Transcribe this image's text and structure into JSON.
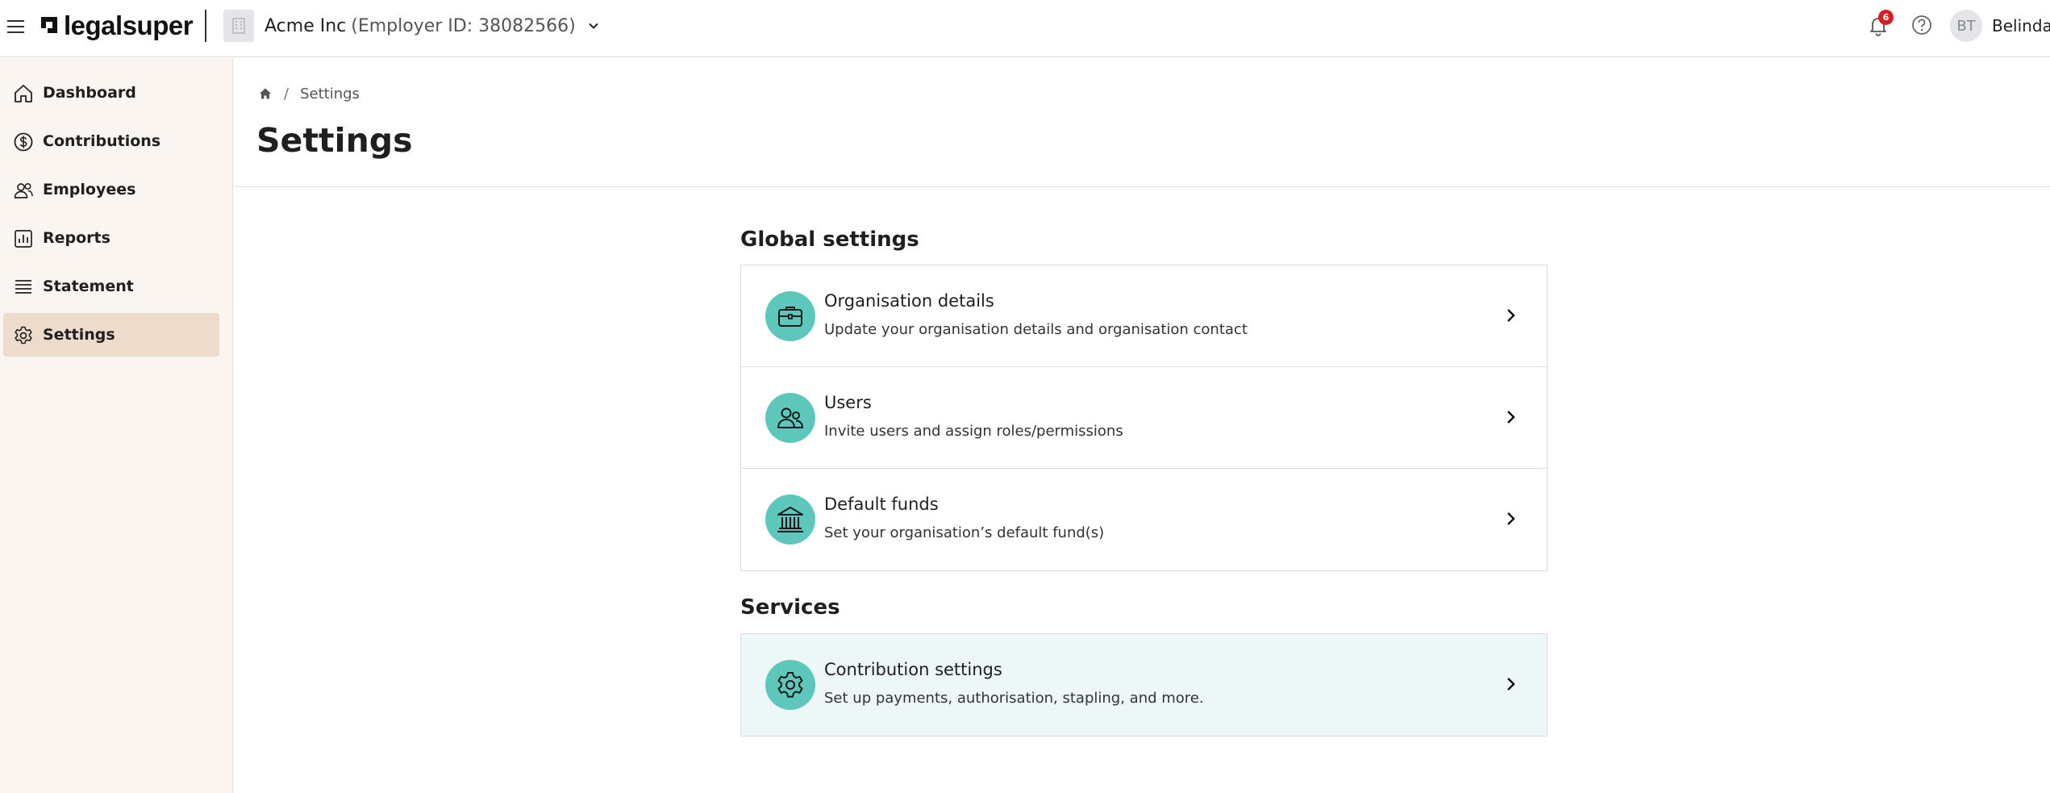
{
  "header": {
    "logo_text": "legalsuper",
    "employer_name": "Acme Inc",
    "employer_id": "(Employer ID: 38082566)",
    "notification_count": "6",
    "user_initials": "BT",
    "user_name": "Belinda",
    "icons": [
      "menu-icon",
      "building-icon",
      "chevron-down-icon",
      "bell-icon",
      "help-icon"
    ]
  },
  "sidebar": {
    "items": [
      {
        "label": "Dashboard",
        "icon": "home-icon"
      },
      {
        "label": "Contributions",
        "icon": "dollar-icon"
      },
      {
        "label": "Employees",
        "icon": "people-icon"
      },
      {
        "label": "Reports",
        "icon": "bar-chart-icon"
      },
      {
        "label": "Statement",
        "icon": "list-icon"
      },
      {
        "label": "Settings",
        "icon": "gear-icon",
        "active": true
      }
    ]
  },
  "breadcrumb": {
    "home_icon": "home-icon",
    "separator": "/",
    "current": "Settings"
  },
  "page": {
    "title": "Settings"
  },
  "global_settings": {
    "title": "Global settings",
    "cards": [
      {
        "title": "Organisation details",
        "description": "Update your organisation details and organisation contact",
        "icon": "briefcase-icon"
      },
      {
        "title": "Users",
        "description": "Invite users and assign roles/permissions",
        "icon": "users-icon"
      },
      {
        "title": "Default funds",
        "description": "Set your organisation’s default fund(s)",
        "icon": "bank-icon"
      }
    ]
  },
  "services": {
    "title": "Services",
    "cards": [
      {
        "title": "Contribution settings",
        "description": "Set up payments, authorisation, stapling, and more.",
        "icon": "gear-icon"
      }
    ]
  },
  "colors": {
    "accent_teal": "#5ec7bb",
    "sidebar_bg": "#faf5f0",
    "sidebar_active": "#eddccb",
    "badge_red": "#d32020",
    "highlight_card_bg": "#eef7f8"
  }
}
